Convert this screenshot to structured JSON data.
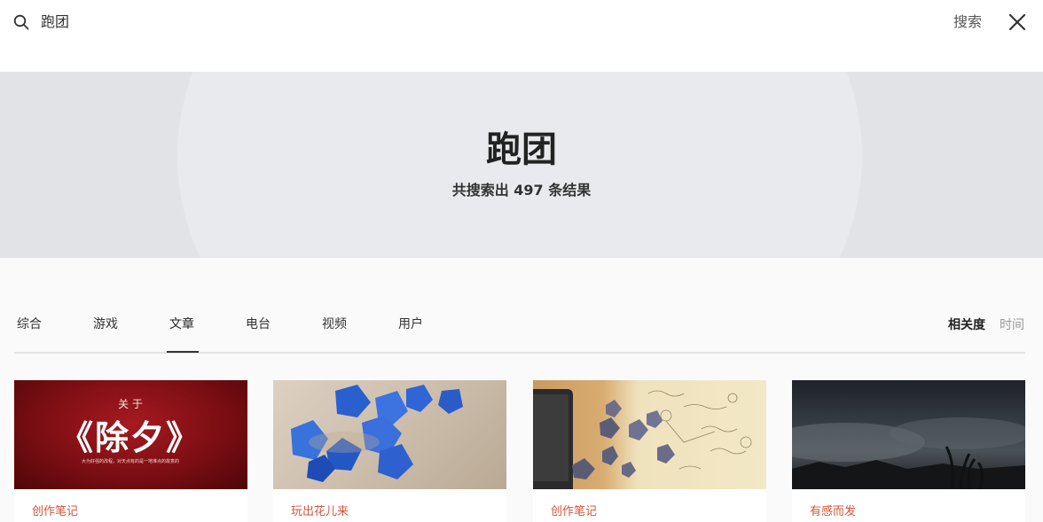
{
  "search": {
    "query": "跑团",
    "button_label": "搜索"
  },
  "hero": {
    "title": "跑团",
    "subtitle": "共搜索出 497 条结果"
  },
  "tabs": [
    {
      "label": "综合"
    },
    {
      "label": "游戏"
    },
    {
      "label": "文章",
      "active": true
    },
    {
      "label": "电台"
    },
    {
      "label": "视频"
    },
    {
      "label": "用户"
    }
  ],
  "sort": {
    "relevance": "相关度",
    "time": "时间",
    "selected": "相关度"
  },
  "cards": [
    {
      "tag": "创作笔记",
      "poster_small": "关 于",
      "poster_big": "《除夕》",
      "poster_tiny": "大为好强的改程，对天点有的是一地准点的故意的"
    },
    {
      "tag": "玩出花儿来"
    },
    {
      "tag": "创作笔记"
    },
    {
      "tag": "有感而发"
    }
  ],
  "colors": {
    "tag": "#d4543a",
    "hero_bg": "#d5d6da",
    "hero_circle": "#e9eaee",
    "page_bg": "#fafafa"
  }
}
